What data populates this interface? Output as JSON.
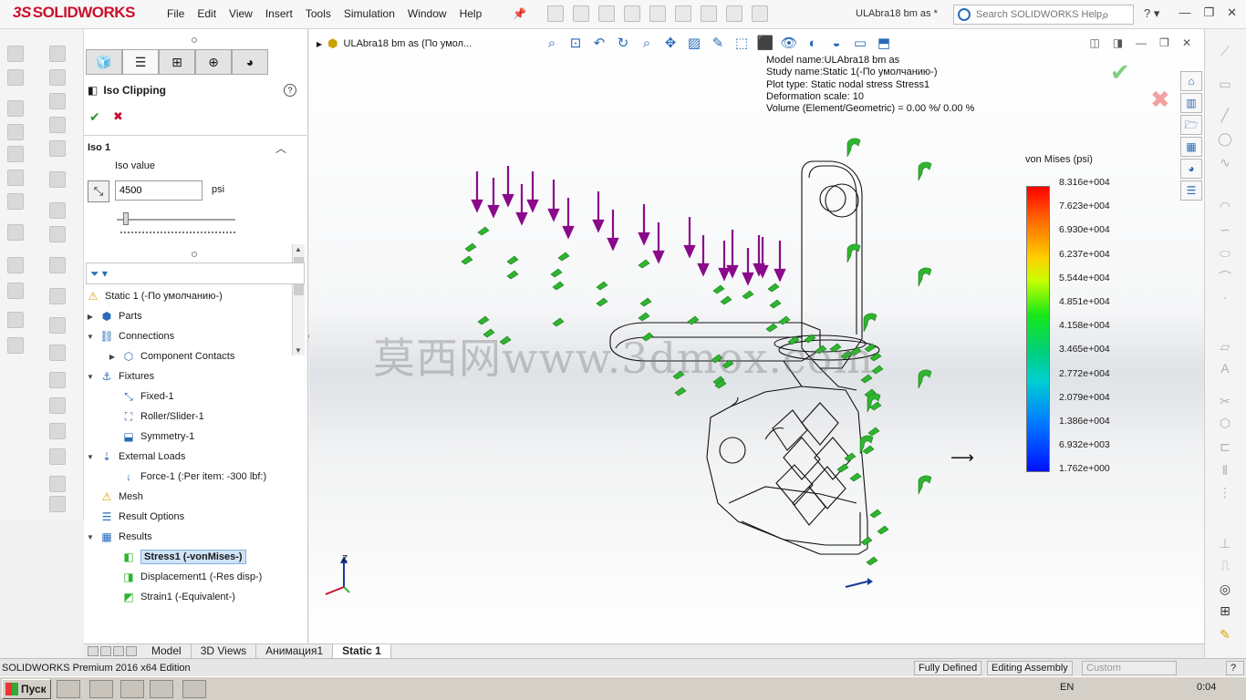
{
  "app": {
    "brand": "SOLIDWORKS",
    "menu": [
      "File",
      "Edit",
      "View",
      "Insert",
      "Tools",
      "Simulation",
      "Window",
      "Help"
    ],
    "document_title": "ULAbra18 bm as *",
    "search_placeholder": "Search SOLIDWORKS Help"
  },
  "property_manager": {
    "tabs": [
      "feature-manager",
      "property-manager",
      "configuration-manager",
      "dimxpert",
      "display-manager"
    ],
    "title": "Iso Clipping",
    "section_title": "Iso 1",
    "iso_label": "Iso value",
    "iso_value": "4500",
    "iso_unit": "psi",
    "slider_position": 0.08
  },
  "tree": {
    "root": "Static 1 (-По умолчанию-)",
    "items": [
      {
        "label": "Parts",
        "icon": "parts-icon",
        "level": 0,
        "expander": "▶"
      },
      {
        "label": "Connections",
        "icon": "connections-icon",
        "level": 0,
        "expander": "▼"
      },
      {
        "label": "Component Contacts",
        "icon": "contacts-icon",
        "level": 1,
        "expander": "▶"
      },
      {
        "label": "Fixtures",
        "icon": "fixtures-icon",
        "level": 0,
        "expander": "▼"
      },
      {
        "label": "Fixed-1",
        "icon": "fixed-icon",
        "level": 1,
        "expander": ""
      },
      {
        "label": "Roller/Slider-1",
        "icon": "roller-icon",
        "level": 1,
        "expander": ""
      },
      {
        "label": "Symmetry-1",
        "icon": "symmetry-icon",
        "level": 1,
        "expander": ""
      },
      {
        "label": "External Loads",
        "icon": "loads-icon",
        "level": 0,
        "expander": "▼"
      },
      {
        "label": "Force-1 (:Per item: -300 lbf:)",
        "icon": "force-icon",
        "level": 1,
        "expander": ""
      },
      {
        "label": "Mesh",
        "icon": "mesh-icon",
        "level": 0,
        "expander": ""
      },
      {
        "label": "Result Options",
        "icon": "result-options-icon",
        "level": 0,
        "expander": ""
      },
      {
        "label": "Results",
        "icon": "results-icon",
        "level": 0,
        "expander": "▼"
      },
      {
        "label": "Stress1 (-vonMises-)",
        "icon": "stress-icon",
        "level": 1,
        "expander": "",
        "selected": true
      },
      {
        "label": "Displacement1 (-Res disp-)",
        "icon": "displacement-icon",
        "level": 1,
        "expander": ""
      },
      {
        "label": "Strain1 (-Equivalent-)",
        "icon": "strain-icon",
        "level": 1,
        "expander": ""
      }
    ]
  },
  "graphics": {
    "tree_label": "ULAbra18 bm as  (По умол...",
    "plot_info": [
      "Model name:ULAbra18 bm as",
      "Study name:Static 1(-По умолчанию-)",
      "Plot type: Static nodal stress Stress1",
      "Deformation scale: 10",
      "Volume (Element/Geometric) = 0.00 %/ 0.00 %"
    ],
    "legend_title": "von Mises (psi)",
    "legend_values": [
      "8.316e+004",
      "7.623e+004",
      "6.930e+004",
      "6.237e+004",
      "5.544e+004",
      "4.851e+004",
      "4.158e+004",
      "3.465e+004",
      "2.772e+004",
      "2.079e+004",
      "1.386e+004",
      "6.932e+003",
      "1.762e+000"
    ],
    "watermark": "莫西网www.3dmox.com",
    "triad_z": "Z"
  },
  "bottom_tabs": [
    "Model",
    "3D Views",
    "Анимация1",
    "Static 1"
  ],
  "status": {
    "edition": "SOLIDWORKS Premium 2016 x64 Edition",
    "defined": "Fully Defined",
    "mode": "Editing Assembly",
    "units": "Custom"
  },
  "taskbar": {
    "start": "Пуск",
    "lang": "EN",
    "clock": "0:04"
  },
  "colors": {
    "brand": "#c8102e",
    "load_arrows": "#8a0a8a",
    "fixtures": "#2fb52f",
    "selection": "#cfe3f7"
  }
}
